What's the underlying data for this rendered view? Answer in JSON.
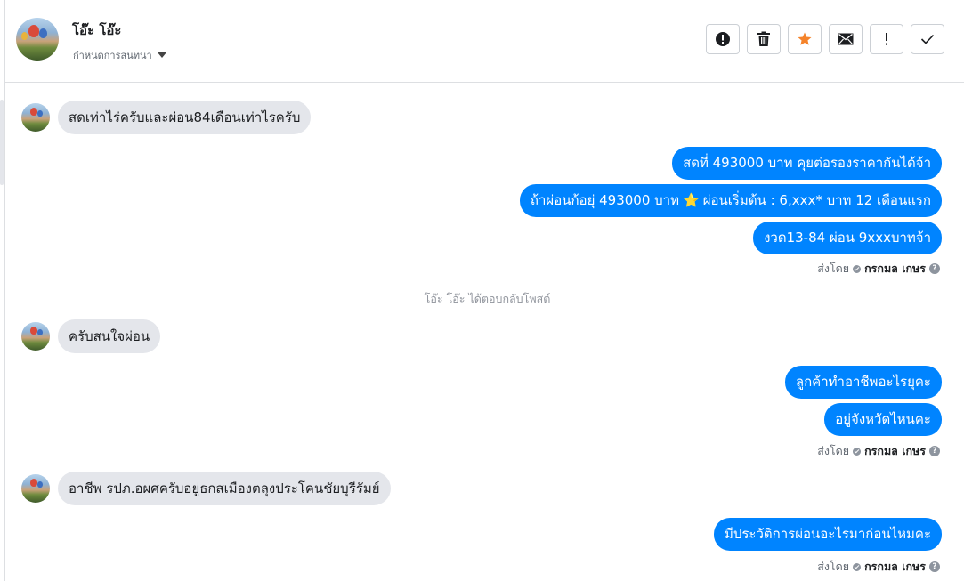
{
  "header": {
    "contact_name": "โอ๊ะ โอ๊ะ",
    "assign_label": "กำหนดการสนทนา",
    "toolbar": [
      {
        "name": "report-spam-icon",
        "label": "!"
      },
      {
        "name": "trash-icon"
      },
      {
        "name": "star-icon"
      },
      {
        "name": "envelope-icon"
      },
      {
        "name": "exclamation-icon",
        "label": "!"
      },
      {
        "name": "checkmark-icon"
      }
    ]
  },
  "messages": {
    "in1": "สดเท่าไร่ครับและผ่อน84เดือนเท่าไรครับ",
    "out1": "สดที่ 493000 บาท คุยต่อรองราคากันได้จ้า",
    "out2a": "ถ้าผ่อนก้อยุ่ 493000 บาท",
    "out2_emoji": "⭐",
    "out2b": "ผ่อนเริ่มต้น : 6,xxx* บาท 12 เดือนแรก",
    "out3": "งวด13-84 ผ่อน 9xxxบาทจ้า",
    "system_note": "โอ๊ะ โอ๊ะ ได้ตอบกลับโพสต์",
    "in2": "ครับสนใจผ่อน",
    "out4": "ลูกค้าทำอาชีพอะไรยุคะ",
    "out5": "อยู่จังหวัดไหนคะ",
    "in3": "อาชีพ รปภ.อผศครับอยู่ธกสเมืองตลุงประโคนชัยบุรีรัมย์",
    "out6": "มีประวัติการผ่อนอะไรมาก่อนไหมคะ"
  },
  "sent_by": {
    "prefix": "ส่งโดย",
    "agent": "กรกมล เกษร",
    "help": "?"
  },
  "colors": {
    "outgoing_bubble": "#0084ff",
    "incoming_bubble": "#e4e6eb",
    "star_accent": "#f5832a"
  }
}
